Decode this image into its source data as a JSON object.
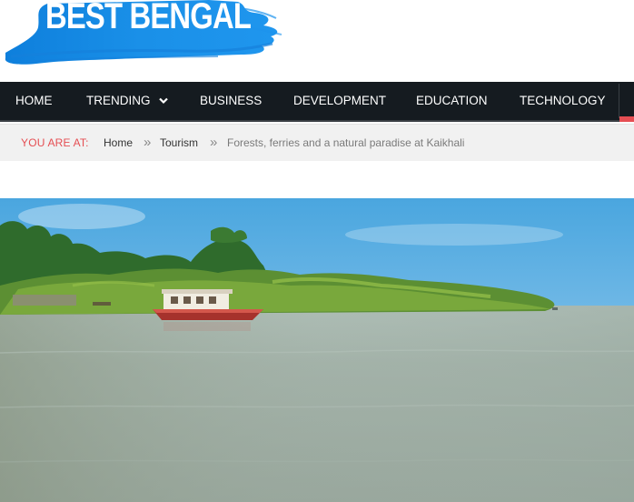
{
  "site": {
    "logo_text": "BEST BENGAL"
  },
  "nav": {
    "items": [
      {
        "label": "HOME"
      },
      {
        "label": "TRENDING",
        "has_dropdown": true
      },
      {
        "label": "BUSINESS"
      },
      {
        "label": "DEVELOPMENT"
      },
      {
        "label": "EDUCATION"
      },
      {
        "label": "TECHNOLOGY"
      }
    ],
    "chevron_icon": "chevron-down-icon"
  },
  "breadcrumb": {
    "label": "YOU ARE AT:",
    "separator": "»",
    "items": [
      {
        "label": "Home"
      },
      {
        "label": "Tourism"
      },
      {
        "label": "Forests, ferries and a natural paradise at Kaikhali"
      }
    ]
  },
  "colors": {
    "nav_background": "#151b20",
    "accent": "#e54e53",
    "logo_brush": "#1a8fe6",
    "breadcrumb_background": "#f1f1f1"
  },
  "featured_image": {
    "subject": "river-mangrove-boat-photo"
  }
}
